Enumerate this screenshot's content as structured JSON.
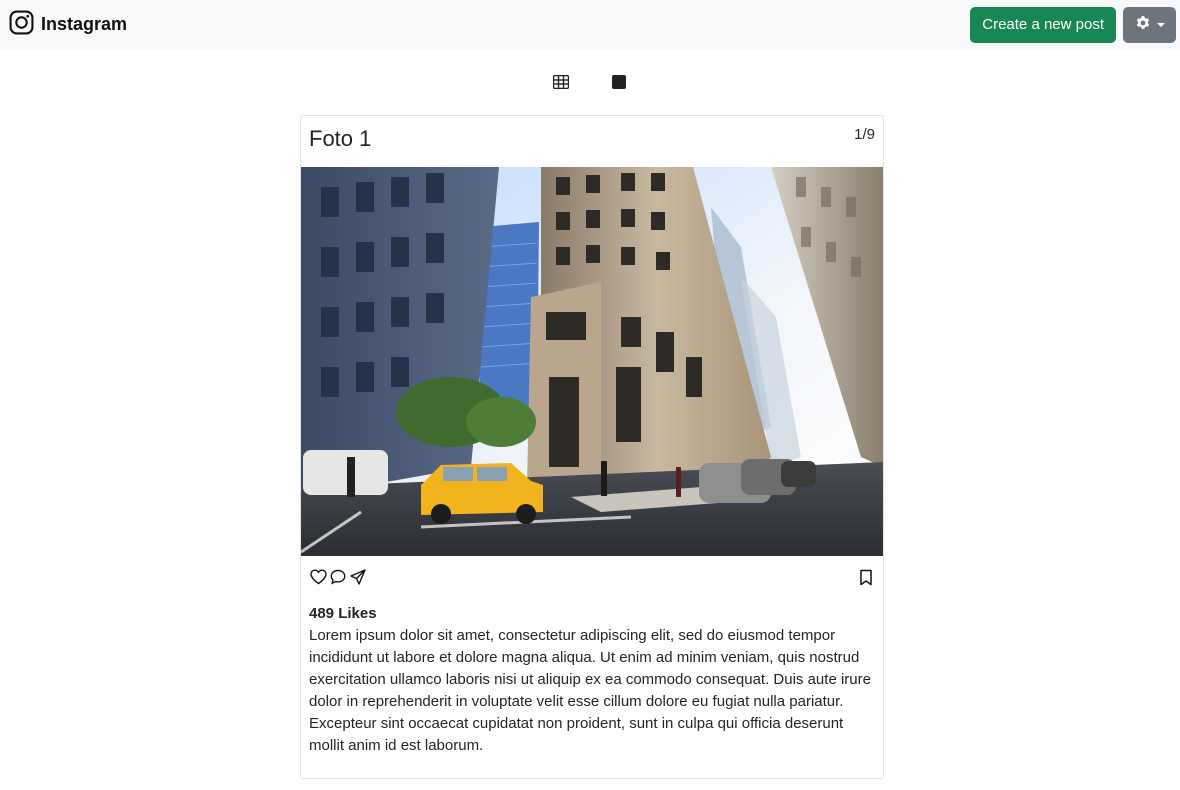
{
  "navbar": {
    "brand": "Instagram",
    "create_label": "Create a new post",
    "settings_icon": "gear-icon"
  },
  "view_toggle": {
    "grid_icon": "grid-icon",
    "single_icon": "square-icon"
  },
  "post": {
    "title": "Foto 1",
    "counter": "1/9",
    "likes": "489 Likes",
    "caption": "Lorem ipsum dolor sit amet, consectetur adipiscing elit, sed do eiusmod tempor incididunt ut labore et dolore magna aliqua. Ut enim ad minim veniam, quis nostrud exercitation ullamco laboris nisi ut aliquip ex ea commodo consequat. Duis aute irure dolor in reprehenderit in voluptate velit esse cillum dolore eu fugiat nulla pariatur. Excepteur sint occaecat cupidatat non proident, sunt in culpa qui officia deserunt mollit anim id est laborum.",
    "photo": "street scene with buildings and yellow taxi"
  },
  "colors": {
    "navbar_bg": "#f8f9fa",
    "create_btn": "#198754",
    "settings_btn": "#6c757d"
  }
}
